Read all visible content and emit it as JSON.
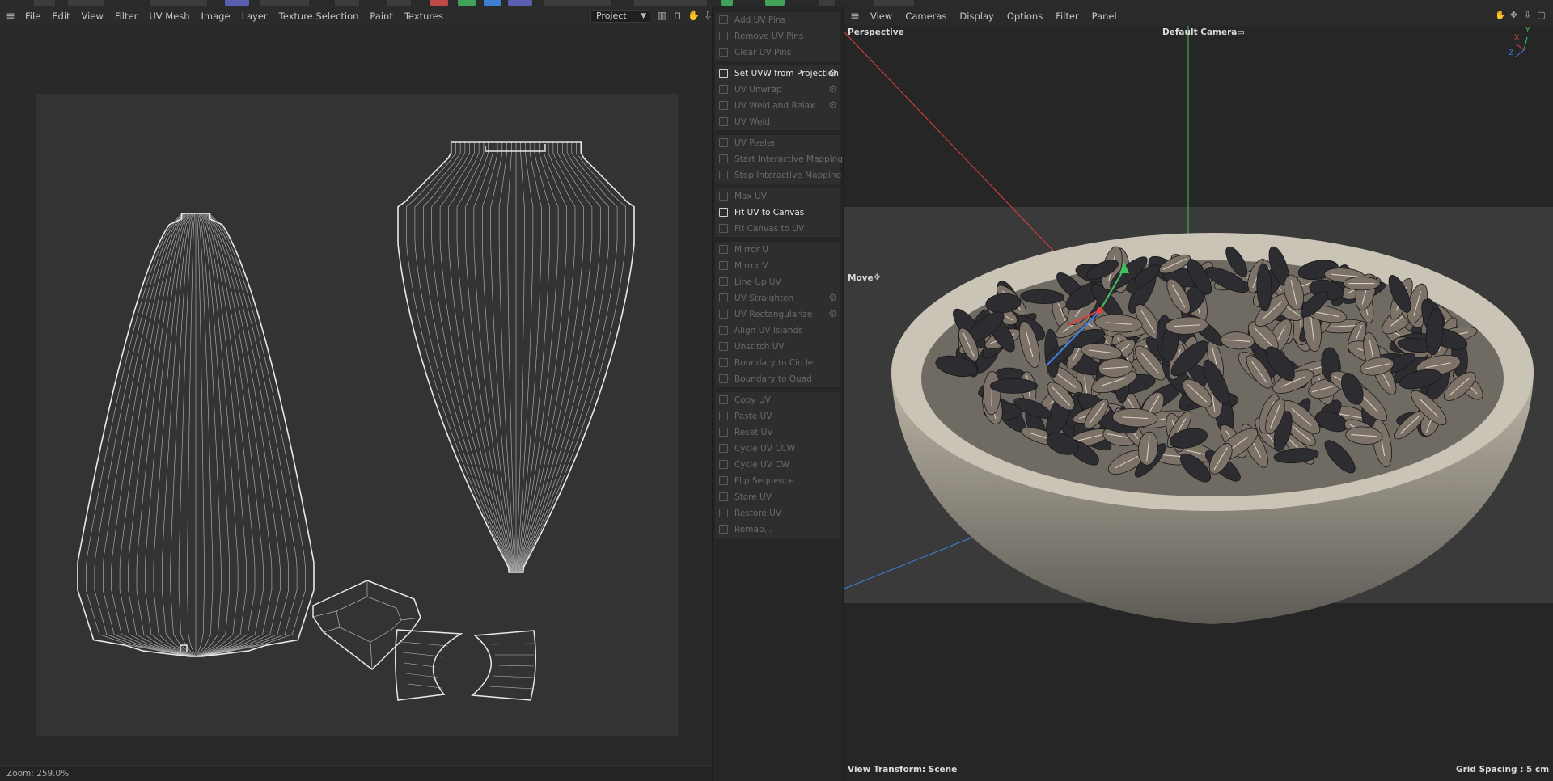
{
  "uv_editor": {
    "menu": [
      "File",
      "Edit",
      "View",
      "Filter",
      "UV Mesh",
      "Image",
      "Layer",
      "Texture Selection",
      "Paint",
      "Textures"
    ],
    "project_select": "Project",
    "status": "Zoom: 259.0%"
  },
  "uv_commands": {
    "groups": [
      [
        {
          "label": "Add UV Pins",
          "enabled": false,
          "gear": false
        },
        {
          "label": "Remove UV Pins",
          "enabled": false,
          "gear": false
        },
        {
          "label": "Clear UV Pins",
          "enabled": false,
          "gear": false
        }
      ],
      [
        {
          "label": "Set UVW from Projection",
          "enabled": true,
          "gear": true
        },
        {
          "label": "UV Unwrap",
          "enabled": false,
          "gear": true
        },
        {
          "label": "UV Weld and Relax",
          "enabled": false,
          "gear": true
        },
        {
          "label": "UV Weld",
          "enabled": false,
          "gear": false
        }
      ],
      [
        {
          "label": "UV Peeler",
          "enabled": false,
          "gear": false
        },
        {
          "label": "Start Interactive Mapping",
          "enabled": false,
          "gear": false
        },
        {
          "label": "Stop Interactive Mapping",
          "enabled": false,
          "gear": false
        }
      ],
      [
        {
          "label": "Max UV",
          "enabled": false,
          "gear": false
        },
        {
          "label": "Fit UV to Canvas",
          "enabled": true,
          "gear": false
        },
        {
          "label": "Fit Canvas to UV",
          "enabled": false,
          "gear": false
        }
      ],
      [
        {
          "label": "Mirror U",
          "enabled": false,
          "gear": false
        },
        {
          "label": "Mirror V",
          "enabled": false,
          "gear": false
        },
        {
          "label": "Line Up UV",
          "enabled": false,
          "gear": false
        },
        {
          "label": "UV Straighten",
          "enabled": false,
          "gear": true
        },
        {
          "label": "UV Rectangularize",
          "enabled": false,
          "gear": true
        },
        {
          "label": "Align UV Islands",
          "enabled": false,
          "gear": false
        },
        {
          "label": "Unstitch UV",
          "enabled": false,
          "gear": false
        },
        {
          "label": "Boundary to Circle",
          "enabled": false,
          "gear": false
        },
        {
          "label": "Boundary to Quad",
          "enabled": false,
          "gear": false
        }
      ],
      [
        {
          "label": "Copy UV",
          "enabled": false,
          "gear": false
        },
        {
          "label": "Paste UV",
          "enabled": false,
          "gear": false
        },
        {
          "label": "Reset UV",
          "enabled": false,
          "gear": false
        },
        {
          "label": "Cycle UV CCW",
          "enabled": false,
          "gear": false
        },
        {
          "label": "Cycle UV CW",
          "enabled": false,
          "gear": false
        },
        {
          "label": "Flip Sequence",
          "enabled": false,
          "gear": false
        },
        {
          "label": "Store UV",
          "enabled": false,
          "gear": false
        },
        {
          "label": "Restore UV",
          "enabled": false,
          "gear": false
        },
        {
          "label": "Remap...",
          "enabled": false,
          "gear": false
        }
      ]
    ]
  },
  "viewport": {
    "menu": [
      "View",
      "Cameras",
      "Display",
      "Options",
      "Filter",
      "Panel"
    ],
    "mode": "Perspective",
    "camera": "Default Camera",
    "tool": "Move",
    "view_transform": "View Transform: Scene",
    "grid_spacing": "Grid Spacing : 5 cm",
    "axis": {
      "x": "X",
      "y": "Y",
      "z": "Z"
    }
  },
  "colors": {
    "accent": "#5a5eb0",
    "wire": "#e8e8e8",
    "axis_x": "#e04040",
    "axis_y": "#40c060",
    "axis_z": "#4080e0"
  }
}
